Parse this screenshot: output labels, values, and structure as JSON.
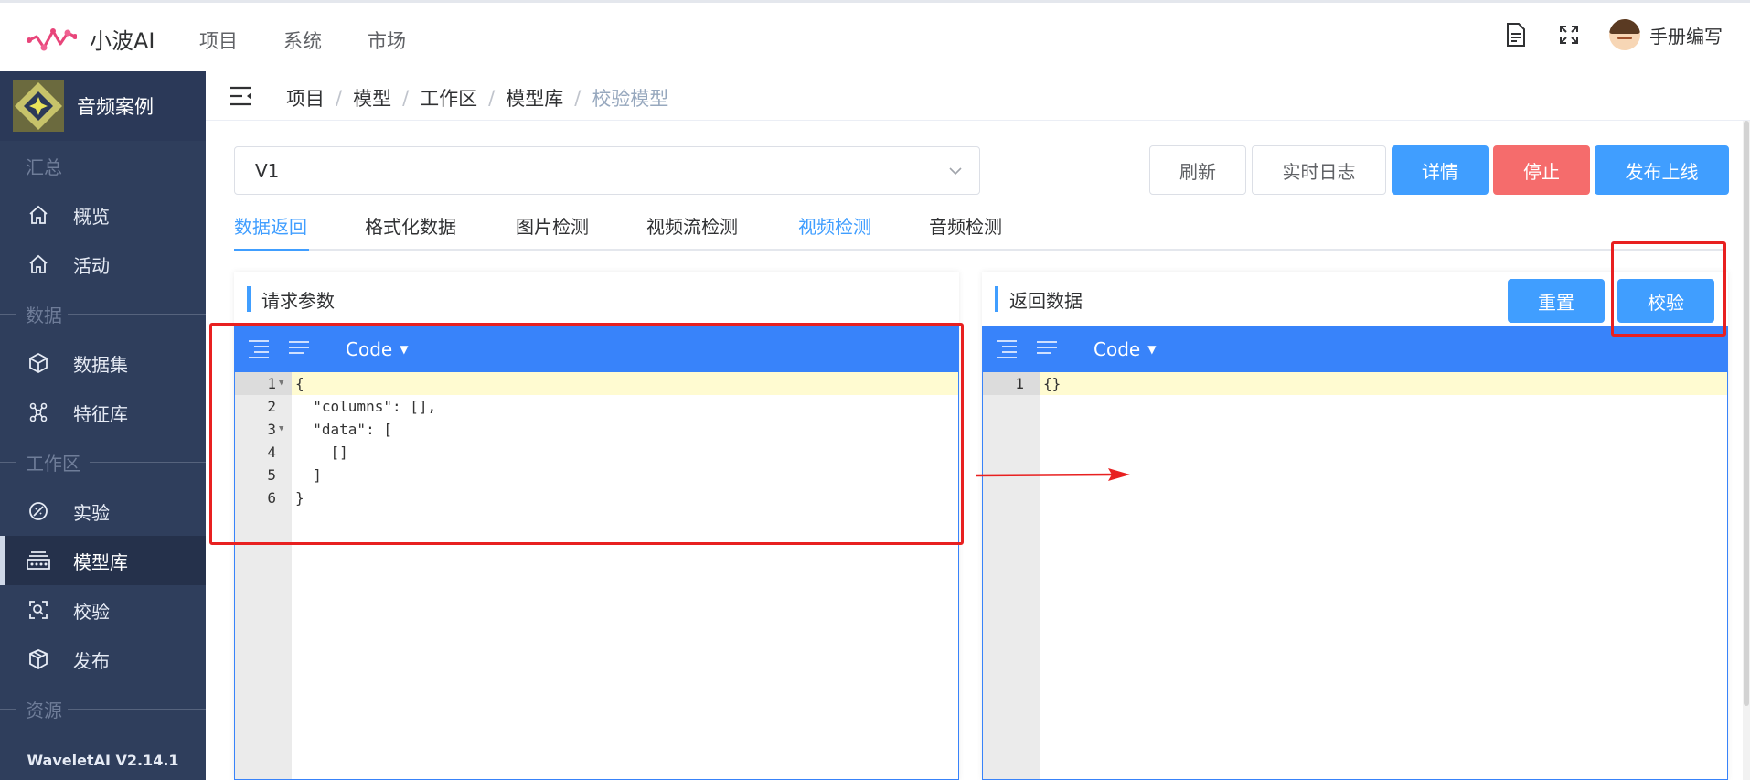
{
  "app": {
    "name": "小波AI"
  },
  "topnav": [
    "项目",
    "系统",
    "市场"
  ],
  "user": {
    "name": "手册编写"
  },
  "sidebar": {
    "project_name": "音频案例",
    "sections": [
      {
        "label": "汇总",
        "items": [
          {
            "label": "概览",
            "icon": "home-icon"
          },
          {
            "label": "活动",
            "icon": "home-icon"
          }
        ]
      },
      {
        "label": "数据",
        "items": [
          {
            "label": "数据集",
            "icon": "cube-icon"
          },
          {
            "label": "特征库",
            "icon": "molecule-icon"
          }
        ]
      },
      {
        "label": "工作区",
        "items": [
          {
            "label": "实验",
            "icon": "flask-icon"
          },
          {
            "label": "模型库",
            "icon": "model-icon",
            "active": true
          },
          {
            "label": "校验",
            "icon": "scan-icon"
          },
          {
            "label": "发布",
            "icon": "box-icon"
          }
        ]
      },
      {
        "label": "资源",
        "items": []
      }
    ],
    "version": "WaveletAI V2.14.1"
  },
  "breadcrumb": [
    "项目",
    "模型",
    "工作区",
    "模型库",
    "校验模型"
  ],
  "version_select": {
    "value": "V1"
  },
  "actions": {
    "refresh": "刷新",
    "live_log": "实时日志",
    "detail": "详情",
    "stop": "停止",
    "publish": "发布上线"
  },
  "tabs": [
    "数据返回",
    "格式化数据",
    "图片检测",
    "视频流检测",
    "视频检测",
    "音频检测"
  ],
  "request_panel": {
    "title": "请求参数",
    "mode": "Code",
    "lines": [
      "{",
      "  \"columns\": [],",
      "  \"data\": [",
      "    []",
      "  ]",
      "}"
    ]
  },
  "response_panel": {
    "title": "返回数据",
    "reset": "重置",
    "validate": "校验",
    "mode": "Code",
    "lines": [
      "{}"
    ]
  },
  "colors": {
    "primary": "#409eff",
    "danger": "#f56c6c",
    "sidebar": "#2f3e5c",
    "editor_toolbar": "#3883fa",
    "annotation": "#e82020"
  }
}
